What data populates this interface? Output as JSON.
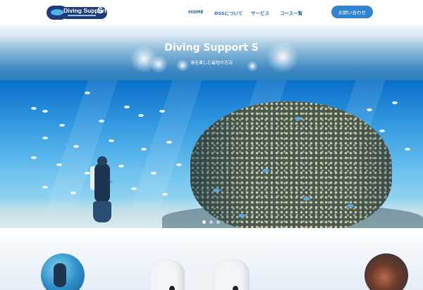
{
  "header": {
    "logo": {
      "name": "Diving Support",
      "mark": "S"
    },
    "nav": [
      "HOME",
      "DSSについて",
      "サービス",
      "コース一覧"
    ],
    "contact_label": "お問い合わせ"
  },
  "hero": {
    "title": "Diving Support S",
    "subtitle": "海を楽しむ最短の方法"
  },
  "colors": {
    "accent": "#2f86cf",
    "nav_text": "#2f6cb3",
    "logo_bg": "#1e3c7a"
  },
  "icons": [
    "logo-mark-icon",
    "slider-dot-icon"
  ],
  "slider": {
    "count": 3,
    "active_index": 0
  }
}
